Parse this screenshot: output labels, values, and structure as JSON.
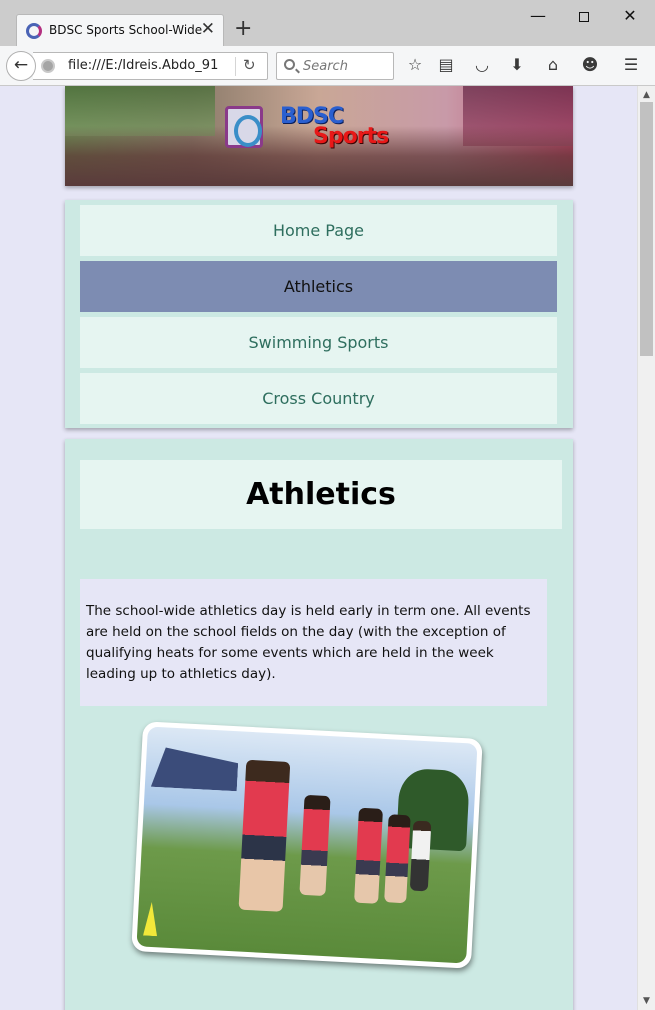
{
  "browser": {
    "tab_title": "BDSC Sports School-Wide",
    "new_tab_symbol": "+",
    "url": "file:///E:/Idreis.Abdo_91",
    "search_placeholder": "Search",
    "icons": [
      "back-arrow-icon",
      "globe-icon",
      "reload-icon",
      "search-icon",
      "bookmark-star-icon",
      "reading-list-icon",
      "pocket-icon",
      "download-icon",
      "home-icon",
      "smiley-icon",
      "hamburger-menu-icon"
    ]
  },
  "banner": {
    "logo_line1": "BDSC",
    "logo_line2": "Sports"
  },
  "nav": {
    "items": [
      {
        "label": "Home Page",
        "active": false
      },
      {
        "label": "Athletics",
        "active": true
      },
      {
        "label": "Swimming Sports",
        "active": false
      },
      {
        "label": "Cross Country",
        "active": false
      }
    ]
  },
  "content": {
    "title": "Athletics",
    "description": "The school-wide athletics day is held early in term one. All events are held on the school fields on the day (with the exception of qualifying heats for some events which are held in the week leading up to athletics day)."
  },
  "colors": {
    "page_bg": "#e6e6f6",
    "panel_bg": "#cce9e3",
    "item_bg": "#e6f5f1",
    "active_item_bg": "#7d8cb2",
    "link_text": "#2e6e5e"
  }
}
